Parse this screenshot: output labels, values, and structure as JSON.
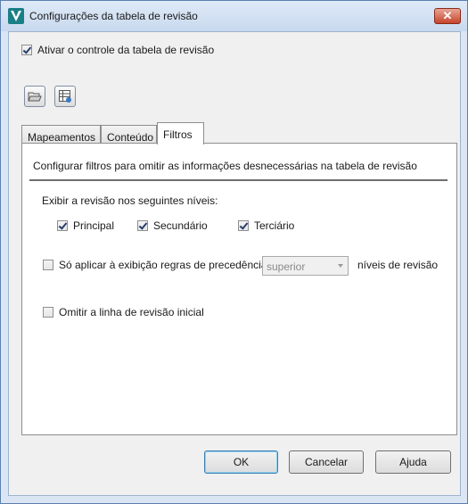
{
  "window": {
    "title": "Configurações da tabela de revisão",
    "close_label": "✕"
  },
  "activate": {
    "label": "Ativar o controle da tabela de revisão",
    "checked": true
  },
  "toolbar": {
    "open_icon": "open-folder-icon",
    "table_icon": "table-settings-icon"
  },
  "tabs": [
    {
      "label": "Mapeamentos"
    },
    {
      "label": "Conteúdo"
    },
    {
      "label": "Filtros",
      "active": true
    }
  ],
  "filters": {
    "description": "Configurar filtros para omitir as informações desnecessárias na tabela de revisão",
    "levels_label": "Exibir a revisão nos seguintes níveis:",
    "levels": [
      {
        "label": "Principal",
        "checked": true
      },
      {
        "label": "Secundário",
        "checked": true
      },
      {
        "label": "Terciário",
        "checked": true
      }
    ],
    "precedence": {
      "label": "Só aplicar à exibição regras de precedência",
      "checked": false,
      "select_value": "superior",
      "suffix": "níveis de revisão"
    },
    "omit_initial": {
      "label": "Omitir a linha de revisão inicial",
      "checked": false
    }
  },
  "buttons": {
    "ok": "OK",
    "cancel": "Cancelar",
    "help": "Ajuda"
  }
}
